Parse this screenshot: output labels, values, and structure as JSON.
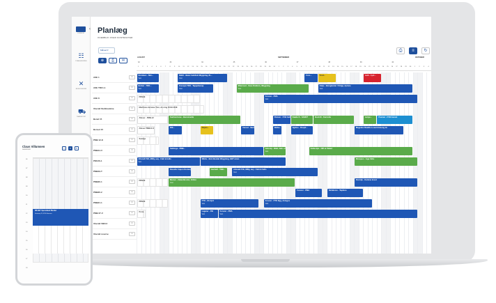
{
  "sidebar": {
    "logo_label": "LOGBOOK",
    "items": [
      {
        "icon": "grid-icon",
        "label": "PLANLÆGNING"
      },
      {
        "icon": "tools-icon",
        "label": "RESSOURCER"
      },
      {
        "icon": "truck-icon",
        "label": "TRANSPORT"
      }
    ]
  },
  "header": {
    "title": "Planlæg",
    "subtitle": "OVERBLIK OVER KONTRAKTER",
    "period": "Måned ▾"
  },
  "timeline": {
    "months": [
      "AUGUST",
      "SEPTEMBER",
      "OKTOBER"
    ],
    "weeks": [
      "32",
      "33",
      "34",
      "35",
      "36",
      "37",
      "38",
      "39",
      "40"
    ],
    "days": [
      "1",
      "2",
      "3",
      "4",
      "5",
      "6",
      "7",
      "8",
      "9",
      "10",
      "11",
      "12",
      "13",
      "14",
      "15",
      "16",
      "17",
      "18",
      "19",
      "20",
      "21",
      "22",
      "23",
      "24",
      "25",
      "26",
      "27",
      "28",
      "29",
      "30",
      "31",
      "1",
      "2",
      "3",
      "4",
      "5",
      "6",
      "7",
      "8",
      "9",
      "10",
      "11",
      "12",
      "13",
      "14",
      "15",
      "16",
      "17",
      "18",
      "19",
      "20",
      "21",
      "22",
      "23",
      "24",
      "25",
      "26",
      "27",
      "28",
      "29",
      "30",
      "1",
      "2",
      "3",
      "4"
    ]
  },
  "resources": [
    {
      "name": "ASE 1",
      "badge": "1"
    },
    {
      "name": "ASE TRC1-1",
      "badge": "1"
    },
    {
      "name": "ASE 8",
      "badge": "1"
    },
    {
      "name": "Uberalt Stellmaskine",
      "badge": "1"
    },
    {
      "name": "Benel 15",
      "badge": "1"
    },
    {
      "name": "Bensel 15",
      "badge": "1"
    },
    {
      "name": "PMB 12-K",
      "badge": "1"
    },
    {
      "name": "PMB14-V",
      "badge": "1"
    },
    {
      "name": "PMV16-1",
      "badge": "1"
    },
    {
      "name": "PMB19-T",
      "badge": "1"
    },
    {
      "name": "PMB20-1",
      "badge": "1"
    },
    {
      "name": "PMB20-2",
      "badge": "1"
    },
    {
      "name": "PMB21-1",
      "badge": "1"
    },
    {
      "name": "PMB 27-V",
      "badge": "1"
    },
    {
      "name": "Uberalt VBN-2",
      "badge": "1"
    },
    {
      "name": "Uberalt reserve",
      "badge": "1"
    }
  ],
  "bars": [
    {
      "title": "Novidenz - Nim...",
      "sub": "Vest",
      "color": "blue"
    },
    {
      "title": "Nildrt - Basic bebilisk tilbygning, 8L...",
      "sub": "Vest",
      "color": "blue"
    },
    {
      "title": "Fors...",
      "sub": "",
      "color": "blue"
    },
    {
      "title": "Fred...",
      "sub": "",
      "color": "yellow"
    },
    {
      "title": "Lark - Lyvi...",
      "sub": "",
      "color": "red"
    },
    {
      "title": "Borker - TRO...",
      "sub": "Vest",
      "color": "blue"
    },
    {
      "title": "Forespa TRO - Tappelnarup",
      "sub": "Vest",
      "color": "blue"
    },
    {
      "title": "Mutersed - Cave Krattom, tilbygning",
      "sub": "Vest",
      "color": "green"
    },
    {
      "title": "Kaljo - Beregleister / Kidge, Aptone",
      "sub": "Vest",
      "color": "blue"
    },
    {
      "title": "PRNJE",
      "sub": "",
      "color": "ghost"
    },
    {
      "title": "Forurer - PMA",
      "sub": "Vest",
      "color": "blue"
    },
    {
      "title": "Marthone Aerwise Tion, do ning 15/19 2018",
      "sub": "",
      "color": "ghost"
    },
    {
      "title": "Alleser - PMB-12",
      "sub": "",
      "color": "gray"
    },
    {
      "title": "Sunhontoree - Bensimedie",
      "sub": "",
      "color": "green"
    },
    {
      "title": "Pamzer - FVB Gebrante",
      "sub": "",
      "color": "blue"
    },
    {
      "title": "Kaalte K - SARET",
      "sub": "",
      "color": "green"
    },
    {
      "title": "Bovinft - Kurnstla",
      "sub": "",
      "color": "green"
    },
    {
      "title": "Lanye...",
      "sub": "",
      "color": "green"
    },
    {
      "title": "Pasmer - FVB Gerant",
      "sub": "",
      "color": "teal"
    },
    {
      "title": "Alleser PMB12-K",
      "sub": "",
      "color": "gray"
    },
    {
      "title": "Rilt...",
      "sub": "",
      "color": "blue"
    },
    {
      "title": "Rapan...",
      "sub": "",
      "color": "yellow"
    },
    {
      "title": "Vensel - Sketnl...",
      "sub": "",
      "color": "blue"
    },
    {
      "title": "Rulba...",
      "sub": "",
      "color": "blue"
    },
    {
      "title": "Sgilme - Rospit...",
      "sub": "",
      "color": "blue"
    },
    {
      "title": "Megedes Reaktion-seal Anmeng do",
      "sub": "",
      "color": "blue"
    },
    {
      "title": "Seadge",
      "sub": "",
      "color": "ghost"
    },
    {
      "title": "Sahkoge - PMB...",
      "sub": "",
      "color": "blue"
    },
    {
      "title": "Antoray - Bikd, Gdn. et Apnecting entMA - Ribkt",
      "sub": "Vest",
      "color": "green"
    },
    {
      "title": "Kolla Ajre - OIF et Vialert",
      "sub": "",
      "color": "green"
    },
    {
      "title": "Allonall FVE, MINy, auy - Fabt & Indls",
      "sub": "Vest",
      "color": "blue"
    },
    {
      "title": "Nildre - Bsin Bestak tilbygning, GBT anvis",
      "sub": "",
      "color": "blue"
    },
    {
      "title": "Rovopeo - Lige tniks",
      "sub": "",
      "color": "green"
    },
    {
      "title": "Ravolfre Vapon Rontarg",
      "sub": "",
      "color": "blue"
    },
    {
      "title": "Ganhaft - TBB...",
      "sub": "",
      "color": "green"
    },
    {
      "title": "Allonall FVE, MINy, auy - Fabt & Indls",
      "sub": "Vest",
      "color": "blue"
    },
    {
      "title": "PRNJE",
      "sub": "",
      "color": "ghost"
    },
    {
      "title": "Mutoro - Nalentbrodor, Vidlon",
      "sub": "Vest",
      "color": "green"
    },
    {
      "title": "Dormlje - Karlene koest",
      "sub": "",
      "color": "blue"
    },
    {
      "title": "Forurer - PMA",
      "sub": "",
      "color": "blue"
    },
    {
      "title": "Sintalcore - Tapiture",
      "sub": "",
      "color": "blue"
    },
    {
      "title": "PRNJE",
      "sub": "",
      "color": "ghost"
    },
    {
      "title": "PTO - Rv bjrd",
      "sub": "Vest",
      "color": "blue"
    },
    {
      "title": "Forurer - PTO Byg, Antegos",
      "sub": "Vest",
      "color": "blue"
    },
    {
      "title": "Poria",
      "sub": "",
      "color": "ghost"
    },
    {
      "title": "Lagarer - Pdi",
      "sub": "Vest",
      "color": "blue"
    },
    {
      "title": "Forurer - PMA",
      "sub": "Vest",
      "color": "blue"
    }
  ],
  "phone": {
    "title": "Claus Villumsen",
    "subtitle": "KALENDER",
    "hours": [
      "06",
      "07",
      "08",
      "09",
      "10",
      "11",
      "12",
      "13",
      "14",
      "15",
      "16",
      "17",
      "18"
    ],
    "event_title": "DB-NET Specielland Blender",
    "event_sub": "Vestervej 25, 8700 Horsens"
  }
}
